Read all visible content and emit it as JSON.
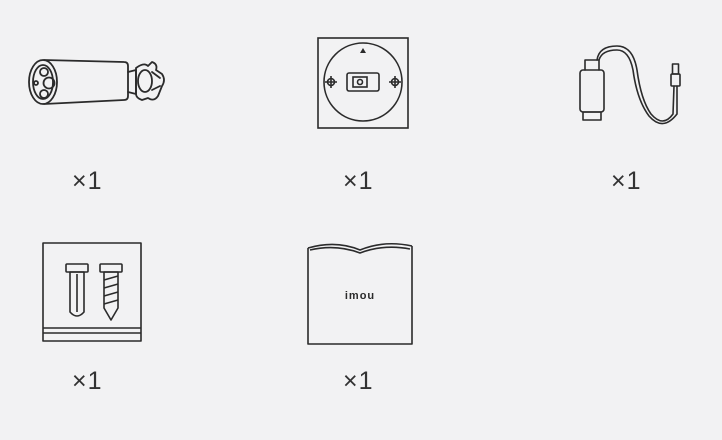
{
  "items": [
    {
      "name": "bullet-camera",
      "quantity": "×1"
    },
    {
      "name": "mounting-template",
      "quantity": "×1"
    },
    {
      "name": "usb-cable",
      "quantity": "×1"
    },
    {
      "name": "screw-package",
      "quantity": "×1"
    },
    {
      "name": "quick-start-guide",
      "quantity": "×1",
      "cover_text": "imou"
    }
  ],
  "icons": {
    "camera": "bullet-camera-icon",
    "template": "mounting-template-icon",
    "cable": "usb-cable-icon",
    "screws": "screw-package-icon",
    "guide": "quick-start-guide-icon"
  },
  "colors": {
    "background": "#f2f2f3",
    "line": "#2b2b2b"
  }
}
